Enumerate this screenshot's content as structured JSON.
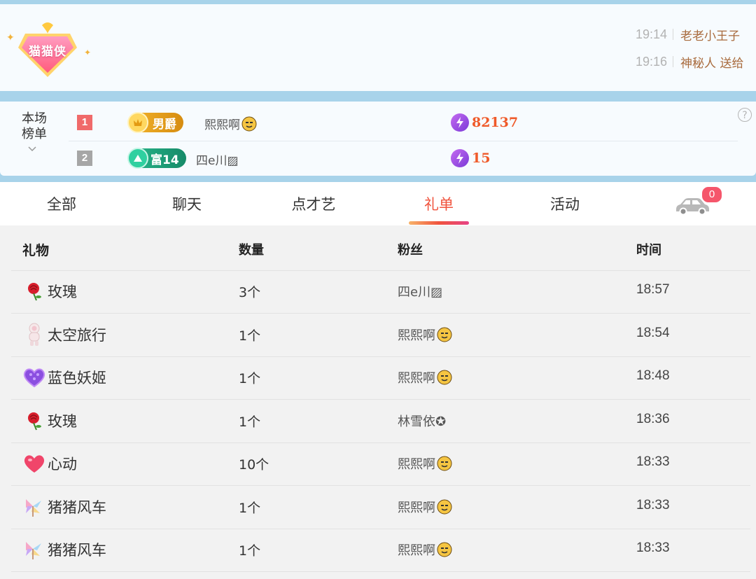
{
  "banner": {
    "badge_text": "猫猫侠",
    "messages": [
      {
        "time": "19:14",
        "text": "老老小王子"
      },
      {
        "time": "19:16",
        "text": "神秘人 送给"
      }
    ]
  },
  "ranking": {
    "title": "本场榜单",
    "help_icon": "question-icon",
    "rows": [
      {
        "rank": "1",
        "level": "男爵",
        "name": "熙熙啊",
        "score": "82137",
        "rank_color": "#f06a6a",
        "badge_color": "#e7a31c"
      },
      {
        "rank": "2",
        "level": "富14",
        "name": "四e川▨",
        "score": "15",
        "rank_color": "#a6a6a6",
        "badge_color": "#1fa37e"
      }
    ]
  },
  "tabs": {
    "items": [
      "全部",
      "聊天",
      "点才艺",
      "礼单",
      "活动"
    ],
    "active": "礼单",
    "car_count": "0"
  },
  "gift_list": {
    "columns": [
      "礼物",
      "数量",
      "粉丝",
      "时间"
    ],
    "rows": [
      {
        "gift": "玫瑰",
        "icon": "rose-icon",
        "qty": "3个",
        "fan": "四e川▨",
        "time": "18:57"
      },
      {
        "gift": "太空旅行",
        "icon": "astronaut-icon",
        "qty": "1个",
        "fan": "熙熙啊",
        "time": "18:54"
      },
      {
        "gift": "蓝色妖姬",
        "icon": "blue-heart-icon",
        "qty": "1个",
        "fan": "熙熙啊",
        "time": "18:48"
      },
      {
        "gift": "玫瑰",
        "icon": "rose-icon",
        "qty": "1个",
        "fan": "林雪依✪",
        "time": "18:36"
      },
      {
        "gift": "心动",
        "icon": "heart-icon",
        "qty": "10个",
        "fan": "熙熙啊",
        "time": "18:33"
      },
      {
        "gift": "猪猪风车",
        "icon": "pinwheel-icon",
        "qty": "1个",
        "fan": "熙熙啊",
        "time": "18:33"
      },
      {
        "gift": "猪猪风车",
        "icon": "pinwheel-icon",
        "qty": "1个",
        "fan": "熙熙啊",
        "time": "18:33"
      }
    ]
  }
}
